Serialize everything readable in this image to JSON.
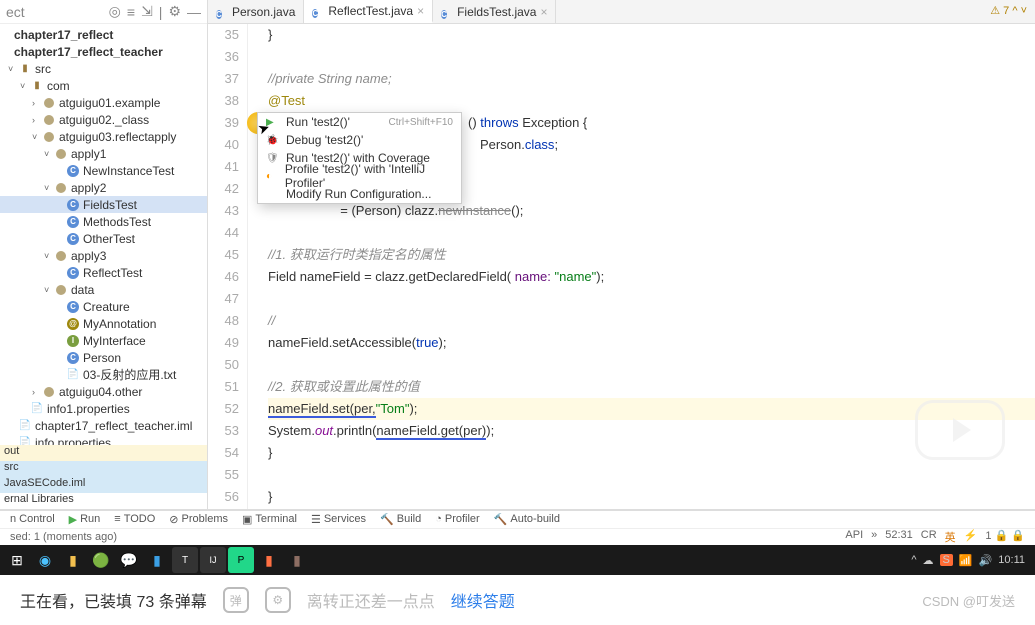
{
  "sidebar": {
    "header_trunc": "ect",
    "roots": [
      "chapter17_reflect",
      "chapter17_reflect_teacher"
    ],
    "src": "src",
    "pkg_com": "com",
    "pkgs": [
      "atguigu01.example",
      "atguigu02._class",
      "atguigu03.reflectapply",
      "atguigu04.other"
    ],
    "apply": [
      "apply1",
      "apply2",
      "apply3"
    ],
    "cls1": [
      "NewInstanceTest"
    ],
    "cls2": [
      "FieldsTest",
      "MethodsTest",
      "OtherTest"
    ],
    "cls3": [
      "ReflectTest"
    ],
    "data": "data",
    "data_cls": [
      "Creature",
      "MyAnnotation",
      "MyInterface",
      "Person"
    ],
    "data_file": "03-反射的应用.txt",
    "info1": "info1.properties",
    "iml": "chapter17_reflect_teacher.iml",
    "info": "info.properties",
    "out": "out",
    "src2": "src",
    "javase": "JavaSECode.iml",
    "extlib": "ernal Libraries"
  },
  "tabs": [
    {
      "label": "Person.java",
      "active": false
    },
    {
      "label": "ReflectTest.java",
      "active": true
    },
    {
      "label": "FieldsTest.java",
      "active": false
    }
  ],
  "warn": "7",
  "lines": [
    "35",
    "36",
    "37",
    "38",
    "39",
    "40",
    "41",
    "42",
    "43",
    "44",
    "45",
    "46",
    "47",
    "48",
    "49",
    "50",
    "51",
    "52",
    "53",
    "54",
    "55",
    "56"
  ],
  "code": {
    "l35": "        }",
    "l37c": "//private String name;",
    "l38": "@Test",
    "l39a": "()",
    "l39b": "throws",
    "l39c": "Exception {",
    "l40a": "Person.",
    "l40b": "class",
    "l40c": ";",
    "l43a": "                    = (Person) clazz.",
    "l43b": "newInstance",
    "l43c": "();",
    "l45c": "//1. 获取运行时类指定名的属性",
    "l46a": "Field nameField = clazz.getDeclaredField( ",
    "l46p": "name:",
    "l46s": "\"name\"",
    "l46e": ");",
    "l48c": "//",
    "l49a": "nameField.setAccessible(",
    "l49b": "true",
    "l49c": ");",
    "l51c": "//2. 获取或设置此属性的值",
    "l52a": "nameField.set(per,",
    "l52s": "\"Tom\"",
    "l52e": ");",
    "l53a": "System.",
    "l53b": "out",
    "l53c": ".println(",
    "l53d": "nameField.get(per)",
    "l53e": ");",
    "l54": "    }",
    "l56": "}"
  },
  "ctx": {
    "run": "Run 'test2()'",
    "run_key": "Ctrl+Shift+F10",
    "debug": "Debug 'test2()'",
    "cov": "Run 'test2()' with Coverage",
    "prof": "Profile 'test2()' with 'IntelliJ Profiler'",
    "mod": "Modify Run Configuration..."
  },
  "bottom": {
    "vc": "n Control",
    "run": "Run",
    "todo": "TODO",
    "prob": "Problems",
    "term": "Terminal",
    "svc": "Services",
    "build": "Build",
    "prof": "Profiler",
    "auto": "Auto-build"
  },
  "status": {
    "left": "sed: 1 (moments ago)",
    "right": [
      "API",
      "»",
      "52:31",
      "CR",
      "英",
      "⚡",
      "1 🔒 🔒"
    ]
  },
  "taskbar_time": "10:11",
  "video": {
    "watching": "王在看，已装填 73 条弹幕",
    "hint": "离转正还差一点点",
    "link": "继续答题",
    "csdn": "CSDN @叮发送"
  }
}
